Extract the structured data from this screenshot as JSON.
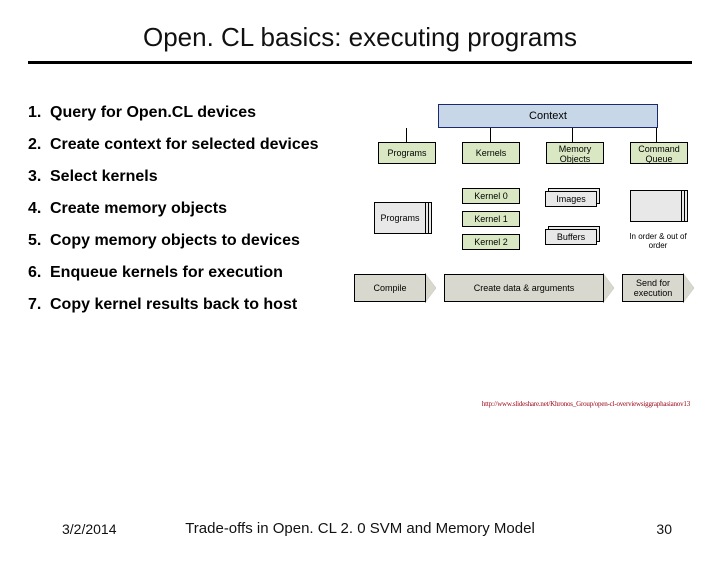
{
  "title": "Open. CL basics: executing programs",
  "steps": [
    {
      "num": "1.",
      "text": "Query for Open.CL devices"
    },
    {
      "num": "2.",
      "text": "Create context for selected devices"
    },
    {
      "num": "3.",
      "text": "Select kernels"
    },
    {
      "num": "4.",
      "text": "Create memory objects"
    },
    {
      "num": "5.",
      "text": "Copy memory objects to devices"
    },
    {
      "num": "6.",
      "text": "Enqueue kernels for execution"
    },
    {
      "num": "7.",
      "text": "Copy kernel results back to host"
    }
  ],
  "diagram": {
    "context": "Context",
    "programs": "Programs",
    "kernels": "Kernels",
    "memory_objects": "Memory Objects",
    "command_queue": "Command Queue",
    "programs2": "Programs",
    "kernel0": "Kernel 0",
    "kernel1": "Kernel 1",
    "kernel2": "Kernel 2",
    "images": "Images",
    "buffers": "Buffers",
    "in_out": "In order & out of order",
    "arrow_compile": "Compile",
    "arrow_create": "Create data & arguments",
    "arrow_send": "Send for execution"
  },
  "citation": "http://www.slideshare.net/Khronos_Group/open-cl-overviewsiggraphasianov13",
  "footer": {
    "date": "3/2/2014",
    "subtitle": "Trade-offs in Open. CL 2. 0 SVM and Memory Model",
    "pagenum": "30"
  }
}
